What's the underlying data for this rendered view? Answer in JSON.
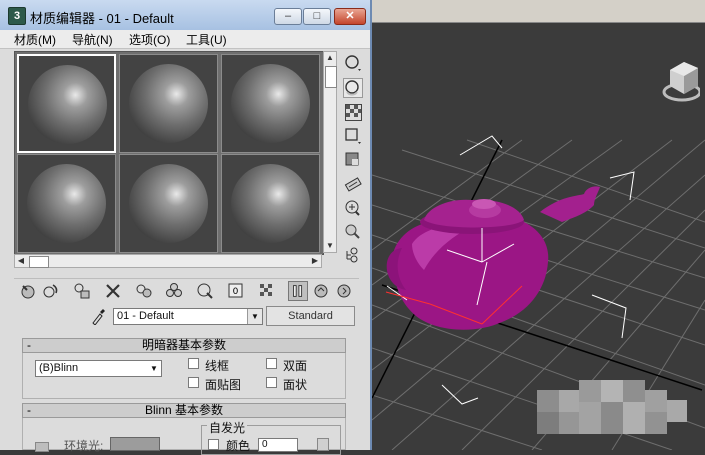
{
  "window": {
    "title": "材质编辑器 - 01 - Default",
    "minimize_glyph": "–",
    "maximize_glyph": "□",
    "close_glyph": "✕",
    "app_icon": "3"
  },
  "menu": {
    "items": [
      "材质(M)",
      "导航(N)",
      "选项(O)",
      "工具(U)"
    ]
  },
  "slots": {
    "count": 6,
    "active_index": 0
  },
  "material": {
    "name": "01 - Default",
    "type_button": "Standard"
  },
  "shader_rollout": {
    "title": "明暗器基本参数",
    "collapse_glyph": "-",
    "shader": "(B)Blinn",
    "options": [
      {
        "label": "线框",
        "checked": false
      },
      {
        "label": "双面",
        "checked": false
      },
      {
        "label": "面贴图",
        "checked": false
      },
      {
        "label": "面状",
        "checked": false
      }
    ]
  },
  "blinn_rollout": {
    "title": "Blinn 基本参数",
    "collapse_glyph": "-",
    "self_illum_title": "自发光",
    "color_label": "颜色",
    "color_value": "0",
    "ambient_label": "环境光:"
  },
  "icons": {
    "right_column": [
      "sample-type-sphere-icon",
      "backlight-icon",
      "background-checker-icon",
      "uv-tiling-icon",
      "video-color-check-icon",
      "make-preview-icon",
      "options-icon",
      "select-by-material-icon",
      "material-map-navigator-icon"
    ],
    "bottom_row": [
      "get-material-icon",
      "put-to-scene-icon",
      "assign-to-selection-icon",
      "reset-map-icon",
      "make-copy-icon",
      "make-unique-icon",
      "put-to-library-icon",
      "material-id-channel-icon",
      "show-map-in-viewport-icon",
      "show-end-result-icon",
      "go-to-parent-icon",
      "go-forward-to-sibling-icon"
    ]
  },
  "colors": {
    "teapot": "#9b1685",
    "viewport_bg": "#3b3b3b",
    "titlebar": "#b8cde8",
    "close_button": "#c4452c"
  }
}
